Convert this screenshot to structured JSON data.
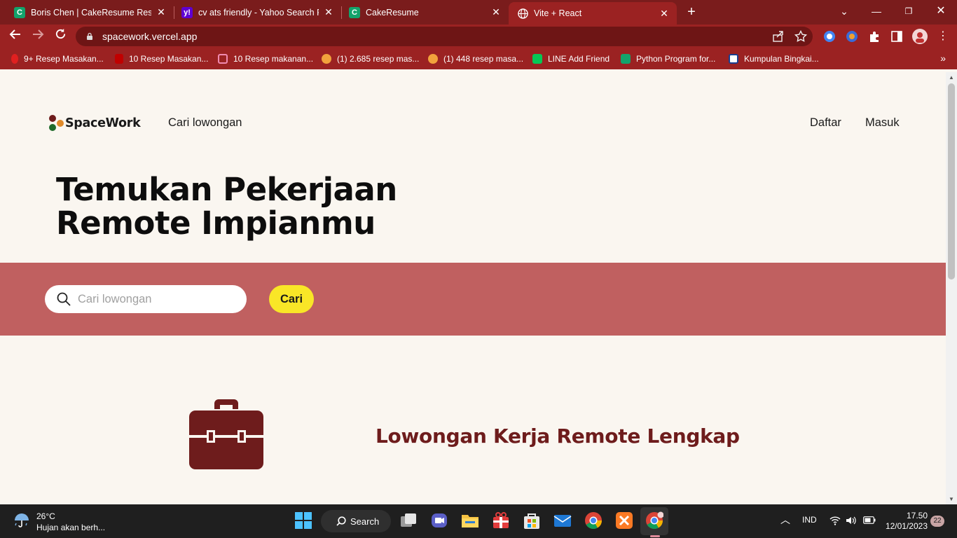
{
  "browser": {
    "tabs": [
      {
        "title": "Boris Chen | CakeResume Resume",
        "icon": "cakeresume-icon",
        "active": false
      },
      {
        "title": "cv ats friendly - Yahoo Search Re",
        "icon": "yahoo-icon",
        "active": false
      },
      {
        "title": "CakeResume",
        "icon": "cakeresume-icon",
        "active": false
      },
      {
        "title": "Vite + React",
        "icon": "globe-icon",
        "active": true
      }
    ],
    "url": "spacework.vercel.app",
    "bookmarks": [
      "9+ Resep Masakan...",
      "10 Resep Masakan...",
      "10 Resep makanan...",
      "(1) 2.685 resep mas...",
      "(1) 448 resep masa...",
      "LINE Add Friend",
      "Python Program for...",
      "Kumpulan Bingkai..."
    ],
    "colors": {
      "frame": "#7a1c1c",
      "toolbar": "#9b2222"
    }
  },
  "page": {
    "brand": "SpaceWork",
    "nav": {
      "search_jobs": "Cari lowongan",
      "register": "Daftar",
      "login": "Masuk"
    },
    "hero": {
      "line1": "Temukan Pekerjaan",
      "line2": "Remote Impianmu"
    },
    "search": {
      "placeholder": "Cari lowongan",
      "button": "Cari"
    },
    "feature": {
      "title": "Lowongan Kerja Remote Lengkap",
      "icon": "briefcase-icon"
    },
    "colors": {
      "background": "#faf6f0",
      "band": "#c06060",
      "accent": "#f9e627",
      "brand_dark": "#6e1c1c"
    }
  },
  "taskbar": {
    "weather": {
      "temp": "26°C",
      "desc": "Hujan akan berh..."
    },
    "search_label": "Search",
    "language": "IND",
    "time": "17.50",
    "date": "12/01/2023",
    "notifications": "22"
  }
}
